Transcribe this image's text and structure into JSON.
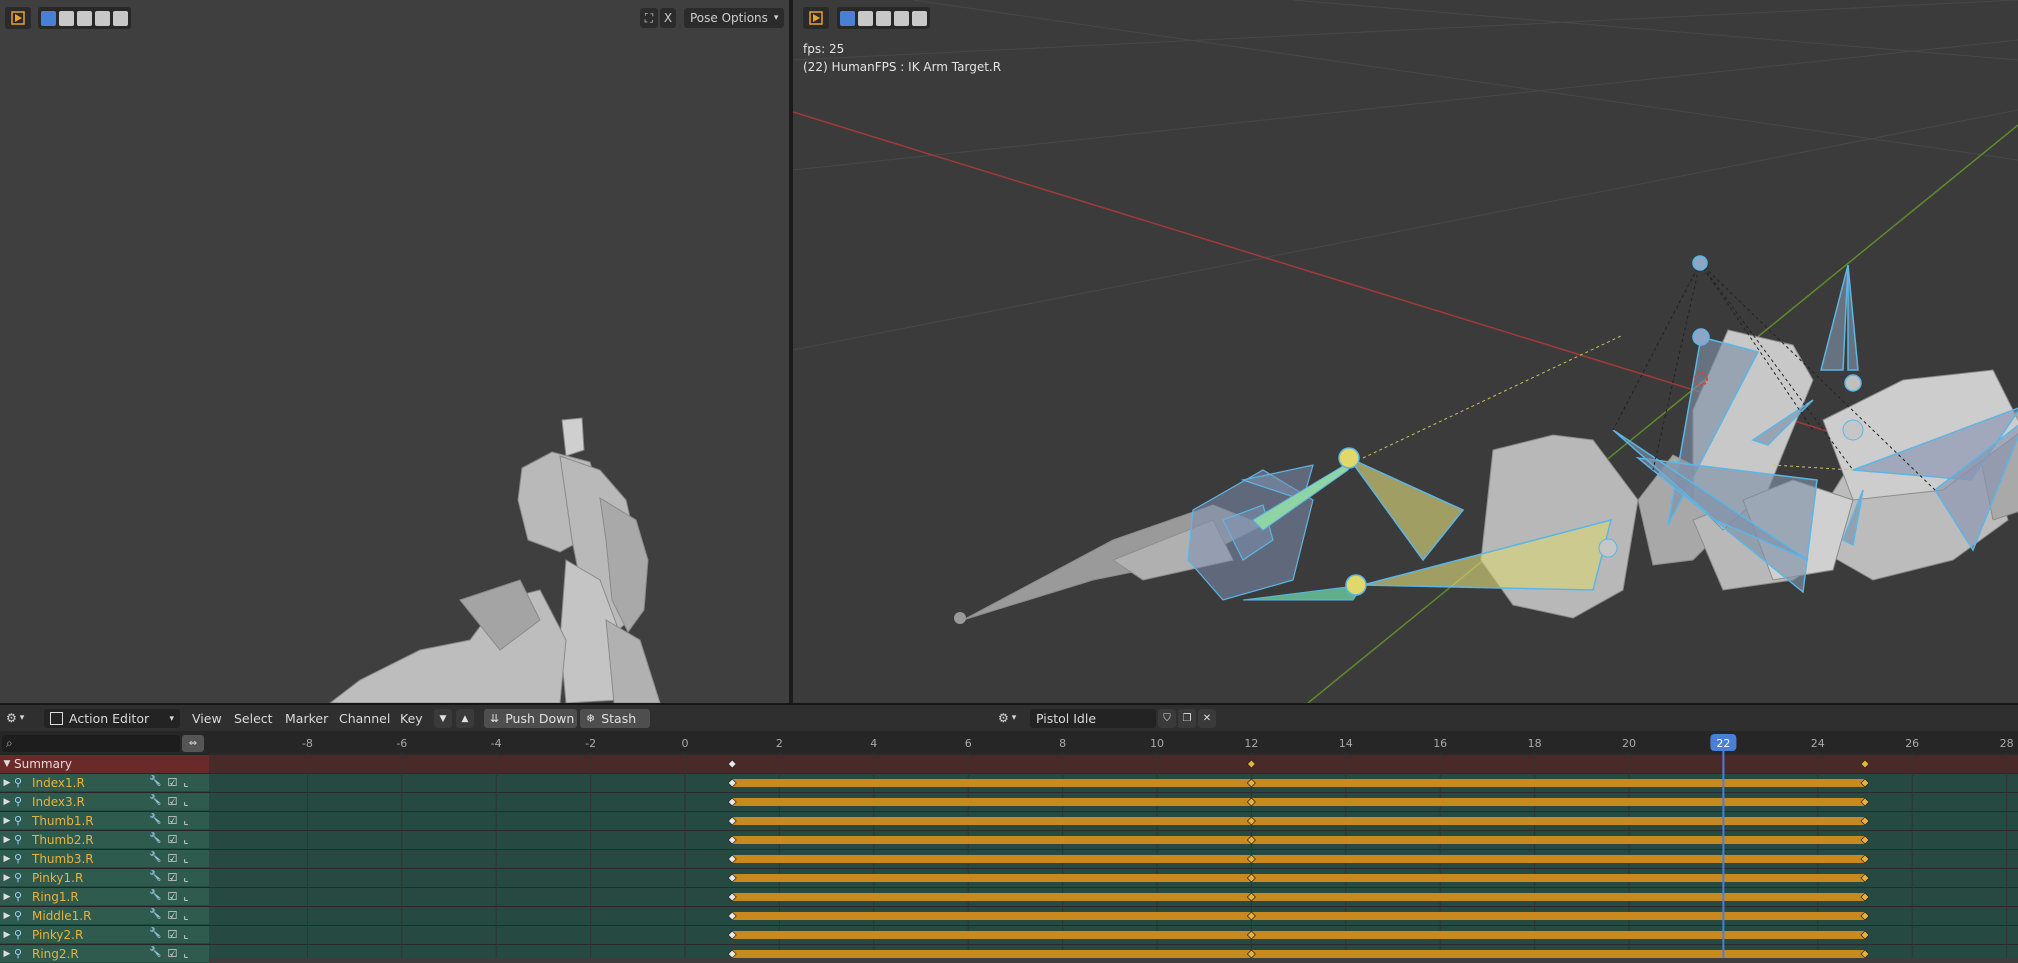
{
  "left_viewport": {
    "pose_options_label": "Pose Options",
    "close_label": "X"
  },
  "right_viewport": {
    "fps_text": "fps: 25",
    "selection_text": "(22) HumanFPS : IK Arm Target.R"
  },
  "dope_sheet": {
    "mode_label": "Action Editor",
    "menus": [
      "View",
      "Select",
      "Marker",
      "Channel",
      "Key"
    ],
    "push_down_label": "Push Down",
    "stash_label": "Stash",
    "action_name": "Pistol Idle",
    "search_placeholder": "",
    "current_frame": "22",
    "frame_labels": [
      "-8",
      "-6",
      "-4",
      "-2",
      "0",
      "2",
      "4",
      "6",
      "8",
      "10",
      "12",
      "14",
      "16",
      "18",
      "20",
      "22",
      "24",
      "26",
      "28"
    ],
    "summary_label": "Summary",
    "channels": [
      "Index1.R",
      "Index3.R",
      "Thumb1.R",
      "Thumb2.R",
      "Thumb3.R",
      "Pinky1.R",
      "Ring1.R",
      "Middle1.R",
      "Pinky2.R",
      "Ring2.R"
    ],
    "keyframes": [
      1,
      12,
      25
    ],
    "colors": {
      "summary_bg": "#6b2a2a",
      "channel_bg": "#2f5a4e",
      "bar": "#c88a1e",
      "playhead": "#4a7fd6",
      "channel_text": "#e9b23c"
    }
  }
}
